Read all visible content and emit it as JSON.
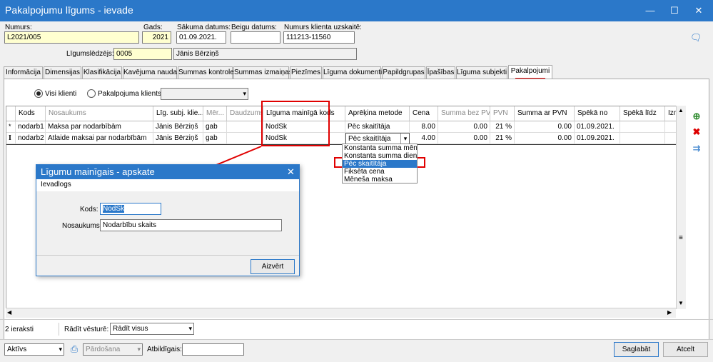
{
  "window": {
    "title": "Pakalpojumu līgums - ievade",
    "min": "—",
    "max": "☐",
    "close": "✕"
  },
  "header": {
    "numurs": {
      "label": "Numurs:",
      "value": "L2021/005"
    },
    "gads": {
      "label": "Gads:",
      "value": "2021"
    },
    "sakuma": {
      "label": "Sākuma datums:",
      "value": "01.09.2021."
    },
    "beigu": {
      "label": "Beigu datums:",
      "value": ""
    },
    "klienta": {
      "label": "Numurs klienta uzskaitē:",
      "value": "111213-11560"
    },
    "ligumsl": {
      "label": "Līgumslēdzējs:",
      "code": "0005",
      "name": "Jānis Bērziņš"
    }
  },
  "tabs": [
    "Informācija",
    "Dimensijas",
    "Klasifikācija",
    "Kavējuma nauda",
    "Summas kontrole",
    "Summas izmaiņas",
    "Piezīmes",
    "Līguma dokumenti",
    "Papildgrupas",
    "Īpašības",
    "Līguma subjekti",
    "Pakalpojumi"
  ],
  "filter": {
    "all_clients": "Visi klienti",
    "service_client": "Pakalpojuma klients:"
  },
  "grid": {
    "columns": [
      "Kods",
      "Nosaukums",
      "Līg. subj. klie...",
      "Mēr...",
      "Daudzums",
      "Līguma mainīgā kods",
      "Aprēķina metode",
      "Cena",
      "Summa bez PVN",
      "PVN",
      "Summa ar PVN",
      "Spēkā no",
      "Spēkā līdz",
      "Izm"
    ],
    "rows": [
      {
        "mark": "*",
        "kods": "nodarb1",
        "nos": "Maksa par nodarbībām",
        "subj": "Jānis Bērziņš",
        "mer": "gab",
        "daudz": "",
        "mk": "NodSk",
        "metode": "Pēc skaitītāja",
        "cena": "8.00",
        "sbez": "0.00",
        "pvn": "21 %",
        "sar": "0.00",
        "no": "01.09.2021.",
        "lidz": ""
      },
      {
        "mark": "I",
        "kods": "nodarb2",
        "nos": "Atlaide maksai par nodarbībām",
        "subj": "Jānis Bērziņš",
        "mer": "gab",
        "daudz": "",
        "mk": "NodSk",
        "metode": "Pēc skaitītāja",
        "cena": "4.00",
        "sbez": "0.00",
        "pvn": "21 %",
        "sar": "0.00",
        "no": "01.09.2021.",
        "lidz": ""
      }
    ],
    "dropdown": [
      "Konstanta summa mēnes",
      "Konstanta summa dienā",
      "Pēc skaitītāja",
      "Fiksēta cena",
      "Mēneša maksa"
    ]
  },
  "dialog": {
    "title": "Līgumu mainīgais - apskate",
    "subtitle": "Ievadlogs",
    "kods_label": "Kods:",
    "kods": "NodSk",
    "nos_label": "Nosaukums:",
    "nos": "Nodarbību skaits",
    "close_btn": "Aizvērt"
  },
  "status": {
    "count": "2 ieraksti",
    "history_label": "Rādīt vēsturē:",
    "history_value": "Rādīt visus"
  },
  "footer": {
    "state": "Aktīvs",
    "sales": "Pārdošana",
    "resp_label": "Atbildīgais:",
    "save": "Saglabāt",
    "cancel": "Atcelt"
  },
  "colors": {
    "accent": "#2b78c9",
    "highlight": "#e00000",
    "yellow": "#ffffd0"
  }
}
